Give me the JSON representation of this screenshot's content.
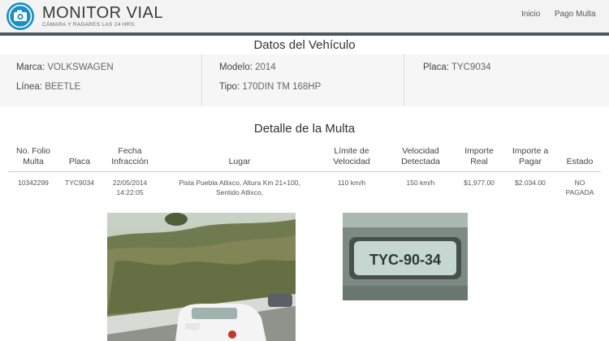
{
  "header": {
    "brand_title": "MONITOR VIAL",
    "brand_subtitle": "CÁMARA Y RADARES LAS 24 HRS.",
    "nav": [
      {
        "label": "Inicio"
      },
      {
        "label": "Pago Multa"
      }
    ],
    "logo_icon": "camera-icon"
  },
  "vehicle": {
    "title": "Datos del Vehículo",
    "fields": [
      {
        "label": "Marca:",
        "value": "VOLKSWAGEN"
      },
      {
        "label": "Línea:",
        "value": "BEETLE"
      },
      {
        "label": "Modelo:",
        "value": "2014"
      },
      {
        "label": "Tipo:",
        "value": "170DIN TM 168HP"
      },
      {
        "label": "Placa:",
        "value": "TYC9034"
      }
    ]
  },
  "detail": {
    "title": "Detalle de la Multa",
    "columns": [
      [
        "No. Folio",
        "Multa"
      ],
      [
        "Placa"
      ],
      [
        "Fecha",
        "Infracción"
      ],
      [
        "Lugar"
      ],
      [
        "Límite de",
        "Velocidad"
      ],
      [
        "Velocidad",
        "Detectada"
      ],
      [
        "Importe",
        "Real"
      ],
      [
        "Importe a",
        "Pagar"
      ],
      [
        "Estado"
      ]
    ],
    "row": [
      [
        "10342299"
      ],
      [
        "TYC9034"
      ],
      [
        "22/05/2014",
        "14:22:05"
      ],
      [
        "Pista Puebla Atlixco, Altura Km 21+100,",
        "Sentido Atlixco,"
      ],
      [
        "110 km/h"
      ],
      [
        "150 km/h"
      ],
      [
        "$1,977.00"
      ],
      [
        "$2,034.00"
      ],
      [
        "NO",
        "PAGADA"
      ]
    ],
    "plate_photo_text": "TYC-90-34"
  },
  "colors": {
    "header_bg": "#f3f3f3",
    "header_rule": "#4a5a64",
    "logo_blue": "#1a8fc4",
    "panel_bg": "#f6f6f6"
  }
}
